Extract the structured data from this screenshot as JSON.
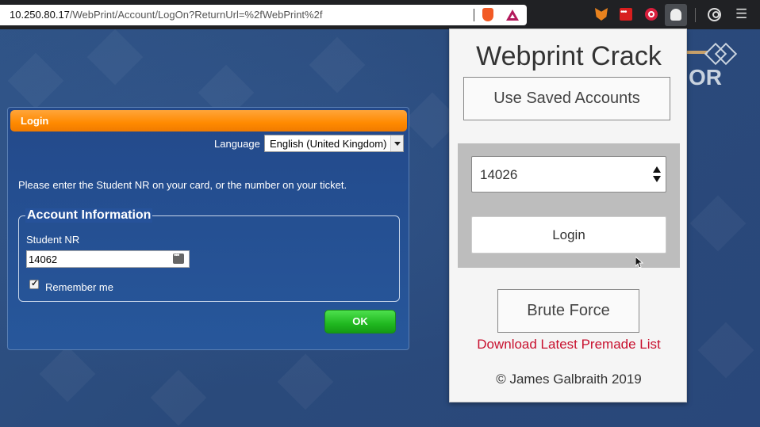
{
  "browser": {
    "url_host": "10.250.80.17",
    "url_path": "/WebPrint/Account/LogOn?ReturnUrl=%2fWebPrint%2f",
    "extensions": [
      "brave-shield-icon",
      "brave-rewards-icon",
      "metamask-icon",
      "lastpass-icon",
      "adblock-ring-icon",
      "webprint-crack-icon"
    ]
  },
  "login_panel": {
    "title": "Login",
    "language_label": "Language",
    "language_value": "English (United Kingdom)",
    "instructions": "Please enter the Student NR on your card, or the number on your ticket.",
    "fieldset_legend": "Account Information",
    "student_label": "Student NR",
    "student_value": "14062",
    "remember_label": "Remember me",
    "remember_checked": true,
    "ok_label": "OK"
  },
  "logo": {
    "text": "OR"
  },
  "popup": {
    "title": "Webprint Crack",
    "saved_accounts_label": "Use Saved Accounts",
    "account_value": "14026",
    "login_label": "Login",
    "brute_force_label": "Brute Force",
    "download_link": "Download Latest Premade List",
    "copyright": "© James Galbraith 2019"
  },
  "colors": {
    "accent_orange": "#ff8a00",
    "ok_green": "#20b820",
    "link_red": "#c8102e",
    "page_blue": "#2a4b7c"
  }
}
